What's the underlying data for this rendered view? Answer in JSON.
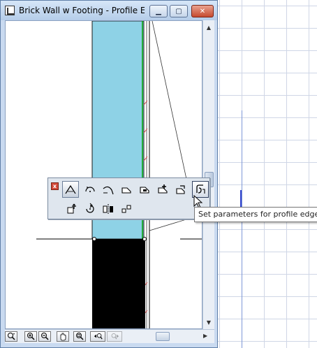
{
  "window": {
    "title": "Brick Wall w Footing - Profile Ed...",
    "minimize_glyph": "▁",
    "maximize_glyph": "▢",
    "close_glyph": "✕"
  },
  "palette": {
    "close_glyph": "x",
    "row1": [
      {
        "name": "straight-edge-icon",
        "state": "active"
      },
      {
        "name": "arc-center-icon"
      },
      {
        "name": "arc-tangent-icon"
      },
      {
        "name": "polygon-icon"
      },
      {
        "name": "polygon-subtract-icon"
      },
      {
        "name": "polygon-add-icon"
      },
      {
        "name": "polygon-offset-icon"
      },
      {
        "name": "edge-parameters-icon",
        "state": "hover"
      }
    ],
    "row2": [
      {
        "name": "move-icon"
      },
      {
        "name": "rotate-icon"
      },
      {
        "name": "mirror-icon"
      },
      {
        "name": "multiply-icon"
      }
    ]
  },
  "tooltip": {
    "text": "Set parameters for profile edge"
  },
  "navigation": {
    "buttons": [
      "zoom-options-icon",
      "zoom-in-icon",
      "zoom-out-icon",
      "pan-icon",
      "zoom-fit-icon",
      "previous-zoom-icon",
      "next-zoom-icon"
    ]
  },
  "colors": {
    "profile_fill": "#8ed2e6",
    "footing_fill": "#000000",
    "accent_line": "#00a000",
    "marker_line": "#cc5555"
  }
}
